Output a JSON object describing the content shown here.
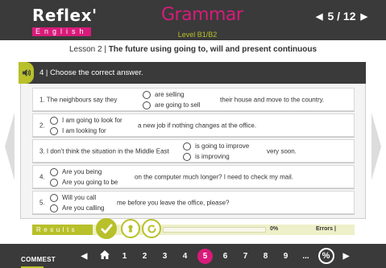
{
  "header": {
    "brand": "Reflex'",
    "brand_sub": "English",
    "section_title": "Grammar",
    "level": "Level B1/B2",
    "pager": {
      "prev_icon": "triangle-left-icon",
      "current": "5 / 12",
      "next_icon": "triangle-right-icon"
    }
  },
  "lesson": {
    "prefix": "Lesson 2 | ",
    "title": "The future using going to, will and present continuous"
  },
  "exercise": {
    "audio_icon": "speaker-icon",
    "instruction": "4 | Choose the correct answer.",
    "items": [
      {
        "before": "1. The neighbours say they",
        "options": [
          "are selling",
          "are going to sell"
        ],
        "after": "their house and move to the country."
      },
      {
        "before": "2.",
        "options": [
          "I am going to look for",
          "I am looking for"
        ],
        "after": "a new job if nothing changes at the office."
      },
      {
        "before": "3. I don't think the situation in the Middle East",
        "options": [
          "is going to improve",
          "is improving"
        ],
        "after": "very soon."
      },
      {
        "before": "4.",
        "options": [
          "Are you being",
          "Are you going to be"
        ],
        "after": "on the computer much longer? I need to check my mail."
      },
      {
        "before": "5.",
        "options": [
          "Will you call",
          "Are you calling"
        ],
        "after": "me before you leave the office, please?"
      }
    ]
  },
  "results": {
    "label": "Results",
    "check_icon": "check-icon",
    "hint_icon": "keyhole-icon",
    "reset_icon": "refresh-icon",
    "progress_fraction": 0,
    "progress_text": "0%",
    "errors_text": "Errors |"
  },
  "footer": {
    "brand": "COMMEST",
    "prev_icon": "triangle-left-icon",
    "home_icon": "home-icon",
    "pages": [
      "1",
      "2",
      "3",
      "4",
      "5",
      "6",
      "7",
      "8",
      "9"
    ],
    "current_page": "5",
    "more": "...",
    "percent_icon": "%",
    "next_icon": "triangle-right-icon"
  },
  "colors": {
    "accent": "#d81b7a",
    "lime": "#b8c02a",
    "dark": "#3a3a3a"
  }
}
